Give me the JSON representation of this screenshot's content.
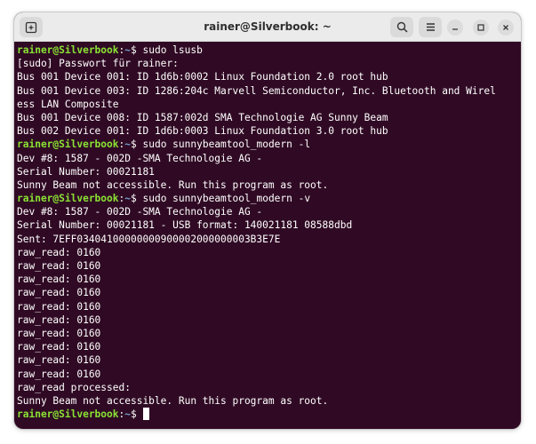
{
  "window": {
    "title": "rainer@Silverbook: ~",
    "icons": {
      "new_tab": "new-tab-icon",
      "search": "search-icon",
      "menu": "hamburger-menu-icon",
      "minimize": "minimize-icon",
      "maximize": "maximize-icon",
      "close": "close-icon"
    }
  },
  "colors": {
    "terminal_bg": "#300a24",
    "prompt_user": "#8ae234",
    "prompt_path": "#729fcf",
    "text": "#ffffff"
  },
  "prompt": {
    "user_host": "rainer@Silverbook",
    "sep": ":",
    "path": "~",
    "symbol": "$ "
  },
  "terminal_lines": [
    {
      "type": "cmd",
      "text": "sudo lsusb"
    },
    {
      "type": "out",
      "text": "[sudo] Passwort für rainer:"
    },
    {
      "type": "out",
      "text": "Bus 001 Device 001: ID 1d6b:0002 Linux Foundation 2.0 root hub"
    },
    {
      "type": "out",
      "text": "Bus 001 Device 003: ID 1286:204c Marvell Semiconductor, Inc. Bluetooth and Wirel"
    },
    {
      "type": "out",
      "text": "ess LAN Composite"
    },
    {
      "type": "out",
      "text": "Bus 001 Device 008: ID 1587:002d SMA Technologie AG Sunny Beam"
    },
    {
      "type": "out",
      "text": "Bus 002 Device 001: ID 1d6b:0003 Linux Foundation 3.0 root hub"
    },
    {
      "type": "cmd",
      "text": "sudo sunnybeamtool_modern -l"
    },
    {
      "type": "out",
      "text": "Dev #8: 1587 - 002D -SMA Technologie AG -"
    },
    {
      "type": "out",
      "text": "Serial Number: 00021181"
    },
    {
      "type": "out",
      "text": "Sunny Beam not accessible. Run this program as root."
    },
    {
      "type": "cmd",
      "text": "sudo sunnybeamtool_modern -v"
    },
    {
      "type": "out",
      "text": "Dev #8: 1587 - 002D -SMA Technologie AG -"
    },
    {
      "type": "out",
      "text": "Serial Number: 00021181 - USB format: 140021181 08588dbd"
    },
    {
      "type": "out",
      "text": "Sent: 7EFF03404100000000900002000000003B3E7E"
    },
    {
      "type": "out",
      "text": "raw_read: 0160"
    },
    {
      "type": "out",
      "text": "raw_read: 0160"
    },
    {
      "type": "out",
      "text": "raw_read: 0160"
    },
    {
      "type": "out",
      "text": "raw_read: 0160"
    },
    {
      "type": "out",
      "text": "raw_read: 0160"
    },
    {
      "type": "out",
      "text": "raw_read: 0160"
    },
    {
      "type": "out",
      "text": "raw_read: 0160"
    },
    {
      "type": "out",
      "text": "raw_read: 0160"
    },
    {
      "type": "out",
      "text": "raw_read: 0160"
    },
    {
      "type": "out",
      "text": "raw_read: 0160"
    },
    {
      "type": "out",
      "text": "raw_read processed:"
    },
    {
      "type": "out",
      "text": "Sunny Beam not accessible. Run this program as root."
    },
    {
      "type": "cmd",
      "text": "",
      "cursor": true
    }
  ]
}
